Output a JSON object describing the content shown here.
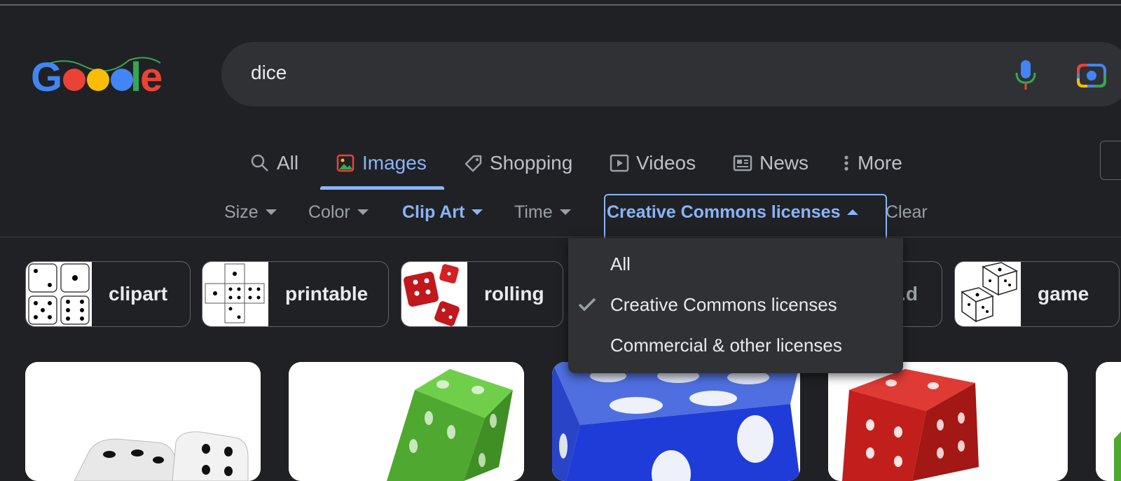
{
  "logo": {
    "text": "Google"
  },
  "search": {
    "query": "dice"
  },
  "tabs": [
    {
      "label": "All",
      "icon": "search-icon"
    },
    {
      "label": "Images",
      "icon": "image-icon"
    },
    {
      "label": "Shopping",
      "icon": "tag-icon"
    },
    {
      "label": "Videos",
      "icon": "play-icon"
    },
    {
      "label": "News",
      "icon": "newspaper-icon"
    },
    {
      "label": "More",
      "icon": "more-vert-icon"
    }
  ],
  "filters": [
    {
      "label": "Size"
    },
    {
      "label": "Color"
    },
    {
      "label": "Clip Art"
    },
    {
      "label": "Time"
    },
    {
      "label": "Creative Commons licenses"
    },
    {
      "label": "Clear"
    }
  ],
  "chips": [
    {
      "label": "clipart"
    },
    {
      "label": "printable"
    },
    {
      "label": "rolling"
    },
    {
      "label": "..d"
    },
    {
      "label": "game"
    }
  ],
  "dropdown": {
    "items": [
      {
        "label": "All",
        "checked": false
      },
      {
        "label": "Creative Commons licenses",
        "checked": true
      },
      {
        "label": "Commercial & other licenses",
        "checked": false
      }
    ]
  },
  "colors": {
    "background": "#202124",
    "accent": "#8ab4f8",
    "surface": "#303134"
  }
}
